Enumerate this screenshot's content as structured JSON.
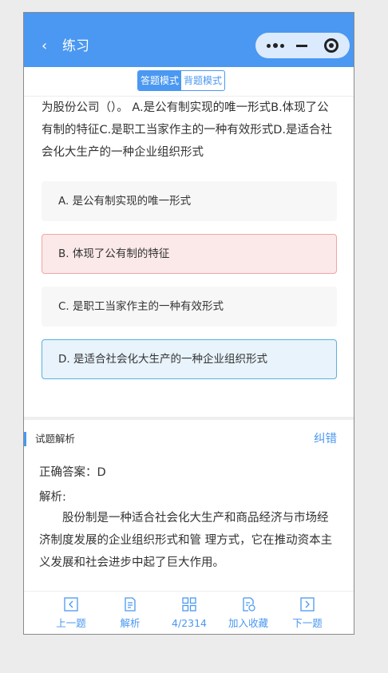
{
  "navbar": {
    "back_icon": "‹",
    "title": "练习"
  },
  "capsule": {
    "menu_icon": "more-dots-icon",
    "minimize_icon": "minus-icon",
    "close_icon": "target-icon"
  },
  "modes": {
    "answer_mode": "答题模式",
    "recite_mode": "背题模式"
  },
  "question": {
    "text": "为股份公司（）。 A.是公有制实现的唯一形式B.体现了公有制的特征C.是职工当家作主的一种有效形式D.是适合社会化大生产的一种企业组织形式"
  },
  "options": [
    {
      "label": "A. 是公有制实现的唯一形式",
      "state": "normal"
    },
    {
      "label": "B. 体现了公有制的特征",
      "state": "wrong"
    },
    {
      "label": "C. 是职工当家作主的一种有效形式",
      "state": "normal"
    },
    {
      "label": "D. 是适合社会化大生产的一种企业组织形式",
      "state": "correct"
    }
  ],
  "analysis": {
    "section_title": "试题解析",
    "report_error": "纠错",
    "answer_line": "正确答案：D",
    "explanation_label": "解析:",
    "explanation_text": "股份制是一种适合社会化大生产和商品经济与市场经济制度发展的企业组织形式和管 理方式，它在推动资本主义发展和社会进步中起了巨大作用。"
  },
  "tabbar": {
    "prev": "上一题",
    "analysis": "解析",
    "progress": "4/2314",
    "favorite": "加入收藏",
    "next": "下一题"
  },
  "colors": {
    "brand": "#4a98f1",
    "wrong_bg": "#fbe8e8",
    "correct_bg": "#e8f3fb"
  }
}
